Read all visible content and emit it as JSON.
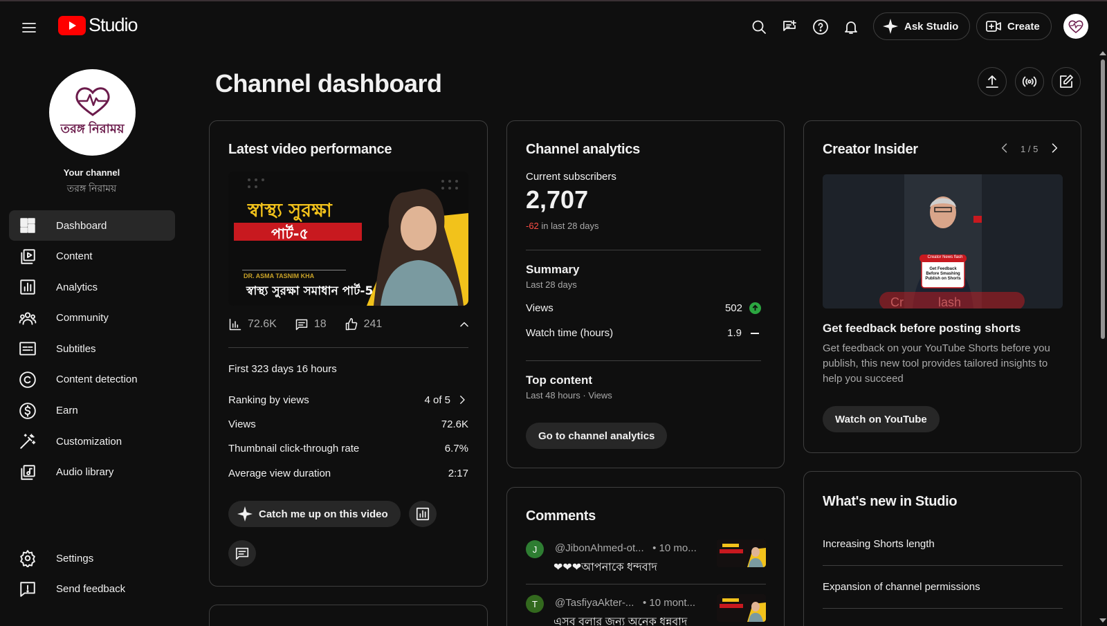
{
  "header": {
    "logo_text": "Studio",
    "ask_label": "Ask Studio",
    "create_label": "Create",
    "avatar_text": "তরঙ্গ নিরাময়"
  },
  "sidebar": {
    "avatar_text": "তরঙ্গ নিরাময়",
    "your_channel": "Your channel",
    "channel_name": "তরঙ্গ নিরাময়",
    "items": [
      {
        "label": "Dashboard",
        "icon": "dashboard-icon",
        "active": true
      },
      {
        "label": "Content",
        "icon": "content-icon"
      },
      {
        "label": "Analytics",
        "icon": "analytics-icon"
      },
      {
        "label": "Community",
        "icon": "community-icon"
      },
      {
        "label": "Subtitles",
        "icon": "subtitles-icon"
      },
      {
        "label": "Content detection",
        "icon": "copyright-icon"
      },
      {
        "label": "Earn",
        "icon": "earn-icon"
      },
      {
        "label": "Customization",
        "icon": "customization-icon"
      },
      {
        "label": "Audio library",
        "icon": "audio-library-icon"
      }
    ],
    "bottom": [
      {
        "label": "Settings",
        "icon": "gear-icon"
      },
      {
        "label": "Send feedback",
        "icon": "feedback-icon"
      }
    ]
  },
  "main": {
    "title": "Channel dashboard"
  },
  "latest": {
    "title": "Latest video performance",
    "thumb_title": "স্বাস্থ্য সুরক্ষা",
    "thumb_part": "পার্ট-৫",
    "thumb_doctor": "DR. ASMA TASNIM KHA",
    "thumb_caption": "স্বাস্থ্য সুরক্ষা সমাধান পার্ট-5",
    "views": "72.6K",
    "comments": "18",
    "likes": "241",
    "period": "First 323 days 16 hours",
    "rows": [
      {
        "label": "Ranking by views",
        "value": "4 of 5"
      },
      {
        "label": "Views",
        "value": "72.6K"
      },
      {
        "label": "Thumbnail click-through rate",
        "value": "6.7%"
      },
      {
        "label": "Average view duration",
        "value": "2:17"
      }
    ],
    "catch_label": "Catch me up on this video"
  },
  "analytics": {
    "title": "Channel analytics",
    "subs_label": "Current subscribers",
    "subs_count": "2,707",
    "subs_delta": "-62",
    "subs_delta_suffix": " in last 28 days",
    "summary_title": "Summary",
    "summary_sub": "Last 28 days",
    "views_label": "Views",
    "views_value": "502",
    "watch_label": "Watch time (hours)",
    "watch_value": "1.9",
    "top_title": "Top content",
    "top_sub": "Last 48 hours · Views",
    "button": "Go to channel analytics"
  },
  "comments": {
    "title": "Comments",
    "items": [
      {
        "initial": "J",
        "color": "#2e7d32",
        "author": "@JibonAhmed-ot...",
        "time": "• 10 mo...",
        "text": "❤❤❤আপনাকে ধন্দবাদ"
      },
      {
        "initial": "T",
        "color": "#33691e",
        "author": "@TasfiyaAkter-...",
        "time": "• 10 mont...",
        "text": "এসব বলার জন্য অনেক ধন্নবাদ"
      }
    ]
  },
  "insider": {
    "title": "Creator Insider",
    "pager": "1 / 5",
    "img_badge": "Creator News flash",
    "img_card": "Get Feedback Before Smashing Publish on Shorts",
    "img_banner": "Cr          lash",
    "item_title": "Get feedback before posting shorts",
    "item_desc": "Get feedback on your YouTube Shorts before you publish, this new tool provides tailored insights to help you succeed",
    "button": "Watch on YouTube"
  },
  "whatsnew": {
    "title": "What's new in Studio",
    "items": [
      "Increasing Shorts length",
      "Expansion of channel permissions"
    ]
  },
  "colors": {
    "background": "#0f0f0f",
    "brand_red": "#ff0000",
    "positive": "#2ba640",
    "negative": "#ff4e45"
  }
}
